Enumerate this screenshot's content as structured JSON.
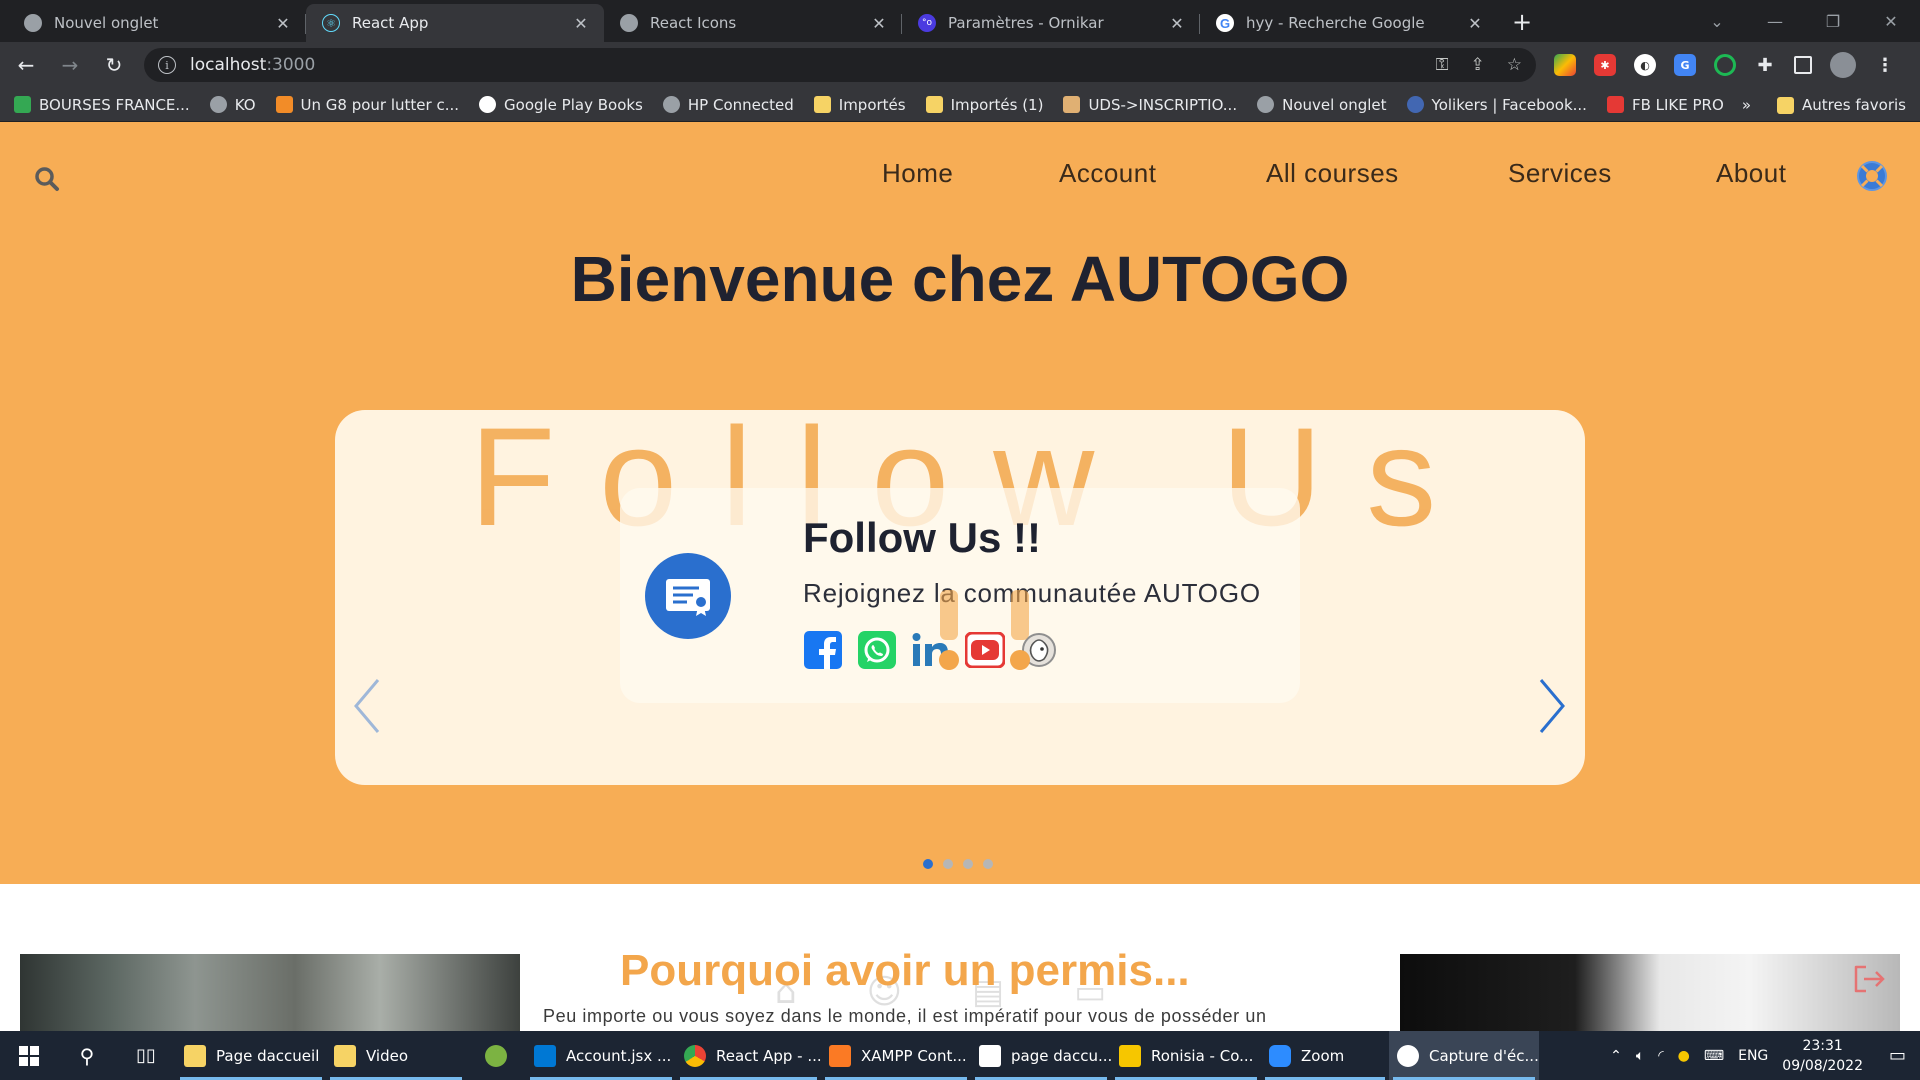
{
  "browser": {
    "tabs": [
      {
        "title": "Nouvel onglet",
        "icon": "chrome-icon",
        "color": "#9aa0a6",
        "active": false
      },
      {
        "title": "React App",
        "icon": "react-icon",
        "color": "#61dafb",
        "active": true
      },
      {
        "title": "React Icons",
        "icon": "globe-icon",
        "color": "#9aa0a6",
        "active": false
      },
      {
        "title": "Paramètres - Ornikar",
        "icon": "ornikar-icon",
        "color": "#4b3be0",
        "active": false
      },
      {
        "title": "hyy - Recherche Google",
        "icon": "google-icon",
        "color": "#ffffff",
        "active": false
      }
    ],
    "url_host": "localhost",
    "url_port": ":3000",
    "bookmarks": [
      {
        "label": "BOURSES FRANCE...",
        "color": "#34a853"
      },
      {
        "label": "KO",
        "color": "#9aa0a6"
      },
      {
        "label": "Un G8 pour lutter c...",
        "color": "#f28c28"
      },
      {
        "label": "Google Play Books",
        "color": "#ffffff"
      },
      {
        "label": "HP Connected",
        "color": "#9aa0a6"
      },
      {
        "label": "Importés",
        "color": "#f6d365"
      },
      {
        "label": "Importés (1)",
        "color": "#f6d365"
      },
      {
        "label": "UDS->INSCRIPTIO...",
        "color": "#e0b073"
      },
      {
        "label": "Nouvel onglet",
        "color": "#9aa0a6"
      },
      {
        "label": "Yolikers | Facebook...",
        "color": "#4267b2"
      },
      {
        "label": "FB LIKE PRO",
        "color": "#e53935"
      }
    ],
    "bookmarks_more": "»",
    "other_bookmarks": "Autres favoris"
  },
  "site": {
    "nav": [
      "Home",
      "Account",
      "All courses",
      "Services",
      "About"
    ],
    "headline_bold": "Bienvenue chez",
    "headline_rest": " AUTOGO",
    "carousel": {
      "bg_title": "Follow Us",
      "card_title": "Follow Us !!",
      "card_subtitle": "Rejoignez la communautée AUTOGO",
      "socials": [
        "facebook-icon",
        "whatsapp-icon",
        "linkedin-icon",
        "youtube-icon",
        "mailchimp-icon"
      ],
      "active_slide": 1,
      "slide_count": 4
    },
    "section_title": "Pourquoi avoir un permis...",
    "section_text": "Peu importe ou vous soyez dans le monde, il est impératif pour vous de posséder un"
  },
  "taskbar": {
    "items": [
      {
        "label": "Page daccueil",
        "color": "#f6d365",
        "running": true
      },
      {
        "label": "Video",
        "color": "#f6d365",
        "running": true
      },
      {
        "label": "",
        "color": "#7cb342",
        "running": false
      },
      {
        "label": "Account.jsx ...",
        "color": "#0078d4",
        "running": true
      },
      {
        "label": "React App - ...",
        "color": "#ea4335",
        "running": true
      },
      {
        "label": "XAMPP Cont...",
        "color": "#fb7a24",
        "running": true
      },
      {
        "label": "page daccu...",
        "color": "#ffffff",
        "running": true
      },
      {
        "label": "Ronisia - Co...",
        "color": "#f6c600",
        "running": true
      },
      {
        "label": "Zoom",
        "color": "#2d8cff",
        "running": true
      },
      {
        "label": "Capture d'éc...",
        "color": "#ffffff",
        "running": true,
        "active": true
      }
    ],
    "lang": "ENG",
    "time": "23:31",
    "date": "09/08/2022"
  }
}
